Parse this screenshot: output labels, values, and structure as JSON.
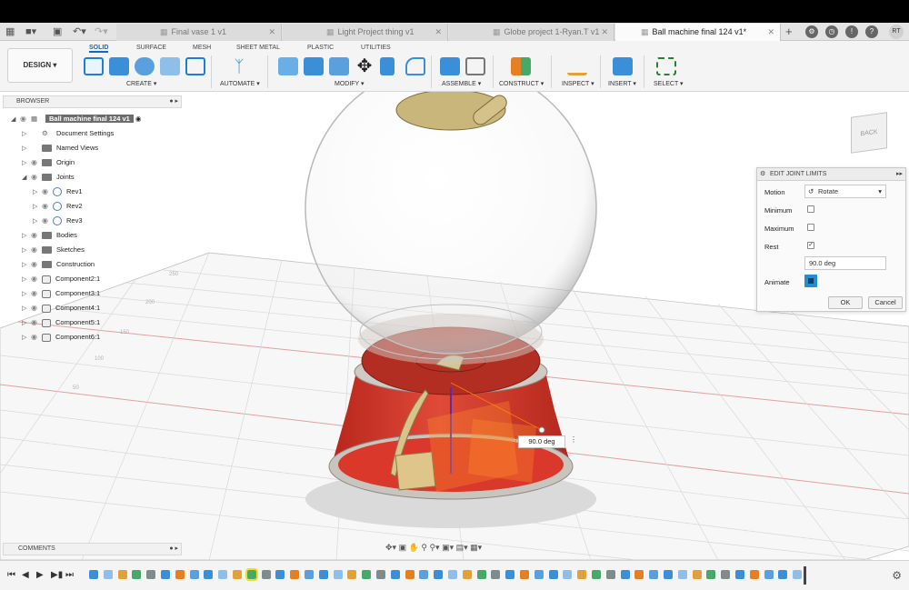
{
  "doc_tabs": [
    {
      "label": "Final vase 1 v1",
      "active": false
    },
    {
      "label": "Light Project thing v1",
      "active": false
    },
    {
      "label": "Globe project 1-Ryan.T v1",
      "active": false
    },
    {
      "label": "Ball machine final 124 v1*",
      "active": true
    }
  ],
  "user_initials": "RT",
  "workspace": {
    "label": "DESIGN"
  },
  "toolbar_tabs": [
    "SOLID",
    "SURFACE",
    "MESH",
    "SHEET METAL",
    "PLASTIC",
    "UTILITIES"
  ],
  "toolbar_groups": [
    "CREATE",
    "AUTOMATE",
    "MODIFY",
    "ASSEMBLE",
    "CONSTRUCT",
    "INSPECT",
    "INSERT",
    "SELECT"
  ],
  "browser": {
    "title": "BROWSER",
    "root": "Ball machine final 124 v1",
    "items": [
      "Document Settings",
      "Named Views",
      "Origin",
      "Joints",
      "Rev1",
      "Rev2",
      "Rev3",
      "Bodies",
      "Sketches",
      "Construction",
      "Component2:1",
      "Component3:1",
      "Component4:1",
      "Component5:1",
      "Component6:1"
    ]
  },
  "joint_panel": {
    "title": "EDIT JOINT LIMITS",
    "motion_label": "Motion",
    "motion_value": "Rotate",
    "minimum_label": "Minimum",
    "minimum_checked": false,
    "maximum_label": "Maximum",
    "maximum_checked": false,
    "rest_label": "Rest",
    "rest_checked": true,
    "rest_value": "90.0 deg",
    "animate_label": "Animate",
    "ok_label": "OK",
    "cancel_label": "Cancel"
  },
  "viewcube": {
    "face": "BACK"
  },
  "angle_input": {
    "value": "90.0 deg"
  },
  "grid_labels": [
    "250",
    "200",
    "150",
    "100",
    "50"
  ],
  "comments": {
    "title": "COMMENTS"
  },
  "colors": {
    "accent": "#0b6bc4",
    "base_red": "#d63a2a",
    "animate_blue": "#1f8fd0"
  }
}
